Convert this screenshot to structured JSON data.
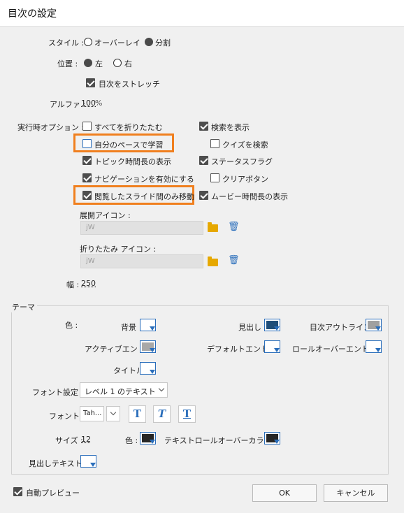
{
  "window": {
    "title": "目次の設定"
  },
  "style": {
    "label": "スタイル :",
    "overlay": "オーバーレイ",
    "split": "分割"
  },
  "position": {
    "label": "位置 :",
    "left": "左",
    "right": "右"
  },
  "stretch": {
    "label": "目次をストレッチ",
    "checked": true
  },
  "alpha": {
    "label": "アルファ :",
    "value": "100",
    "unit": "%"
  },
  "runtime": {
    "label": "実行時オプション :",
    "collapse_all": "すべてを折りたたむ",
    "search": "検索を表示",
    "self_paced": "自分のペースで学習",
    "quiz_search": "クイズを検索",
    "topic_duration": "トピック時間長の表示",
    "status_flag": "ステータスフラグ",
    "enable_nav": "ナビゲーションを有効にする",
    "clear_button": "クリアボタン",
    "move_visited": "閲覧したスライド間のみ移動",
    "movie_duration": "ムービー時間長の表示"
  },
  "expand_icon": {
    "label": "展開アイコン :",
    "value": "jW"
  },
  "collapse_icon": {
    "label": "折りたたみ アイコン :",
    "value": "jW"
  },
  "width": {
    "label": "幅 :",
    "value": "250"
  },
  "theme": {
    "group_label": "テーマ",
    "color_label": "色 :",
    "background": "背景",
    "heading": "見出し",
    "toc_outline": "目次アウトライン",
    "active_entry": "アクティブエントリ",
    "default_entry": "デフォルトエントリ",
    "rollover_entry": "ロールオーバーエントリ",
    "title": "タイトル",
    "font_setting_label": "フォント設定 :",
    "font_setting_value": "レベル 1 のテキスト",
    "font_label": "フォント :",
    "font_value": "Tah...",
    "t_bold": "T",
    "t_italic": "T",
    "t_underline": "T",
    "size_label": "サイズ :",
    "size_value": "12",
    "text_color_label": "色 :",
    "text_rollover_label": "テキストロールオーバーカラー :",
    "heading_text": "見出しテキスト",
    "colors": {
      "background": "#ffffff",
      "heading": "#1f4e79",
      "toc_outline": "#a0a0a0",
      "active_entry": "#a8a8a8",
      "default_entry": "#ffffff",
      "rollover_entry": "#ffffff",
      "title": "#ffffff",
      "text_color": "#262626",
      "text_rollover": "#262626",
      "heading_text": "#ffffff"
    }
  },
  "footer": {
    "auto_preview": "自動プレビュー",
    "ok": "OK",
    "cancel": "キャンセル"
  },
  "accent": "#f07f1e"
}
